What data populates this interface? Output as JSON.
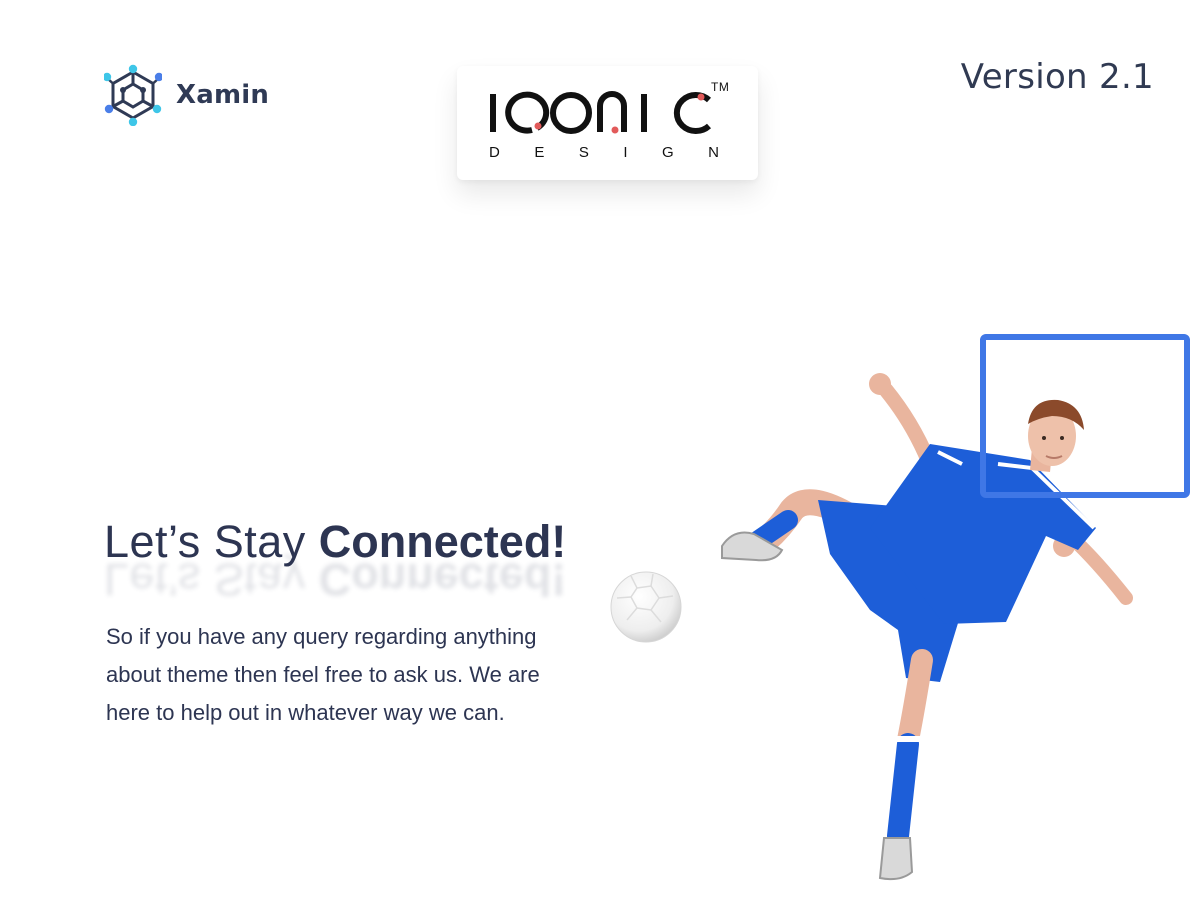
{
  "brand": {
    "name": "Xamin",
    "logo_icon": "hexagon-network-icon",
    "colors": {
      "primary": "#2f3a55",
      "accent_cyan": "#3ec6e8",
      "accent_blue": "#4a7ee8"
    }
  },
  "partner_logo": {
    "wordmark": "IQONIC",
    "subtitle": [
      "D",
      "E",
      "S",
      "I",
      "G",
      "N"
    ],
    "trademark": "TM",
    "dot_color": "#e25a5a"
  },
  "version": "Version 2.1",
  "hero": {
    "title_light": "Let’s Stay ",
    "title_bold": "Connected!",
    "body": "So if you have any query regarding anything about theme then feel free to ask us. We are here to help out in whatever way we can.",
    "text_color": "#2d3552"
  },
  "illustration": {
    "subject": "soccer-player-kicking",
    "ball": "soccer-ball-icon",
    "frame_color": "#3f77e6",
    "jersey_color": "#1d5ed8"
  }
}
